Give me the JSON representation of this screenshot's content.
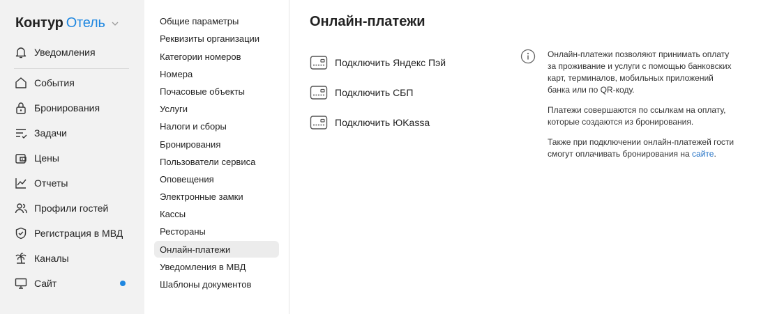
{
  "logo": {
    "part1": "Контур",
    "part2": "Отель"
  },
  "colors": {
    "accent": "#1f87e0",
    "sidebar_bg": "#f2f2f2",
    "active_bg": "#ececec"
  },
  "sidebar": {
    "items": [
      {
        "label": "Уведомления",
        "icon": "bell-icon"
      },
      {
        "label": "События",
        "icon": "home-icon"
      },
      {
        "label": "Бронирования",
        "icon": "lock-icon"
      },
      {
        "label": "Задачи",
        "icon": "tasks-icon"
      },
      {
        "label": "Цены",
        "icon": "wallet-icon"
      },
      {
        "label": "Отчеты",
        "icon": "chart-icon"
      },
      {
        "label": "Профили гостей",
        "icon": "users-icon"
      },
      {
        "label": "Регистрация в МВД",
        "icon": "shield-icon"
      },
      {
        "label": "Каналы",
        "icon": "palm-icon"
      },
      {
        "label": "Сайт",
        "icon": "monitor-icon",
        "has_dot": true
      }
    ]
  },
  "submenu": {
    "items": [
      "Общие параметры",
      "Реквизиты организации",
      "Категории номеров",
      "Номера",
      "Почасовые объекты",
      "Услуги",
      "Налоги и сборы",
      "Бронирования",
      "Пользователи сервиса",
      "Оповещения",
      "Электронные замки",
      "Кассы",
      "Рестораны",
      "Онлайн-платежи",
      "Уведомления в МВД",
      "Шаблоны документов"
    ],
    "active_index": 13
  },
  "main": {
    "title": "Онлайн-платежи",
    "options": [
      {
        "label": "Подключить Яндекс Пэй"
      },
      {
        "label": "Подключить СБП"
      },
      {
        "label": "Подключить ЮKassa"
      }
    ],
    "info": {
      "p1": "Онлайн-платежи позволяют принимать оплату за проживание и услуги с помощью банковских карт, терминалов, мобильных приложений банка или по QR-коду.",
      "p2": "Платежи совершаются по ссылкам на оплату, которые создаются из бронирования.",
      "p3": "Также при подключении онлайн-платежей гости смогут оплачивать бронирования на",
      "p3_link": "сайте",
      "p3_end": "."
    }
  }
}
